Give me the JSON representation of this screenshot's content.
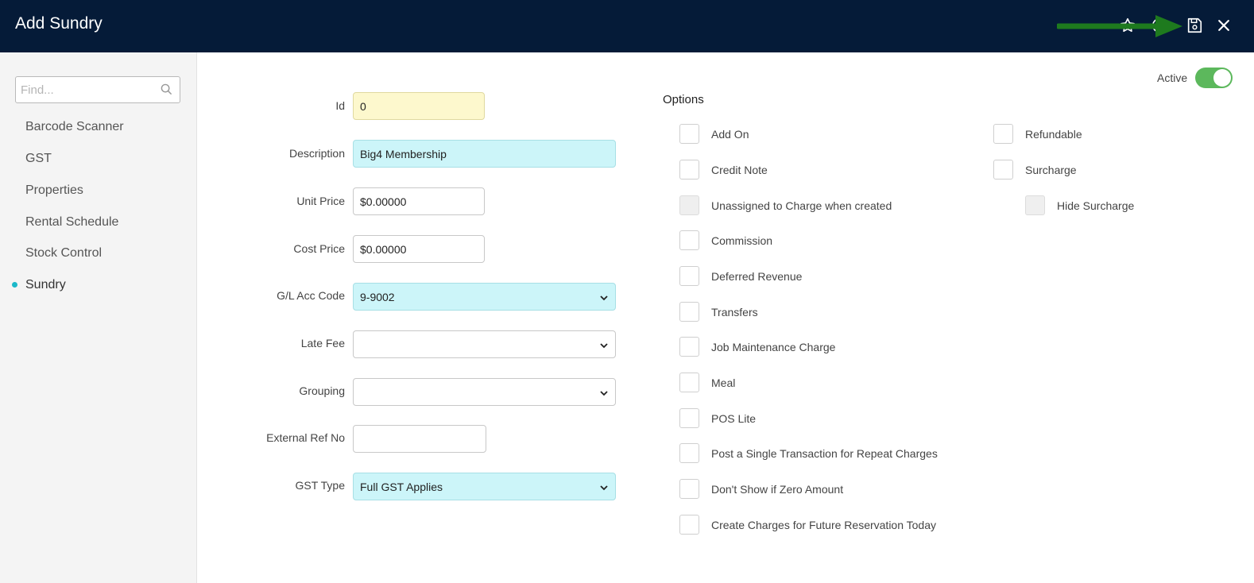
{
  "header": {
    "title": "Add Sundry",
    "icons": [
      "star-icon",
      "help-icon",
      "save-icon",
      "close-icon"
    ],
    "colors": {
      "background": "#051b38",
      "annotation_arrow": "#1e7a1e"
    }
  },
  "sidebar": {
    "search_placeholder": "Find...",
    "items": [
      {
        "label": "Barcode Scanner"
      },
      {
        "label": "GST"
      },
      {
        "label": "Properties"
      },
      {
        "label": "Rental Schedule"
      },
      {
        "label": "Stock Control"
      },
      {
        "label": "Sundry",
        "active": true
      }
    ]
  },
  "form": {
    "id": {
      "label": "Id",
      "value": "0"
    },
    "description": {
      "label": "Description",
      "value": "Big4 Membership"
    },
    "unit_price": {
      "label": "Unit Price",
      "value": "$0.00000"
    },
    "cost_price": {
      "label": "Cost Price",
      "value": "$0.00000"
    },
    "gl_acc_code": {
      "label": "G/L Acc Code",
      "value": "9-9002"
    },
    "late_fee": {
      "label": "Late Fee",
      "value": ""
    },
    "grouping": {
      "label": "Grouping",
      "value": ""
    },
    "external_ref_no": {
      "label": "External Ref No",
      "value": ""
    },
    "gst_type": {
      "label": "GST Type",
      "value": "Full GST Applies"
    }
  },
  "options": {
    "title": "Options",
    "left": [
      {
        "label": "Add On",
        "checked": false
      },
      {
        "label": "Credit Note",
        "checked": false
      },
      {
        "label": "Unassigned to Charge when created",
        "checked": false,
        "disabled": true
      },
      {
        "label": "Commission",
        "checked": false
      },
      {
        "label": "Deferred Revenue",
        "checked": false
      },
      {
        "label": "Transfers",
        "checked": false
      },
      {
        "label": "Job Maintenance Charge",
        "checked": false
      },
      {
        "label": "Meal",
        "checked": false
      },
      {
        "label": "POS Lite",
        "checked": false
      },
      {
        "label": "Post a Single Transaction for Repeat Charges",
        "checked": false
      },
      {
        "label": "Don't Show if Zero Amount",
        "checked": false
      },
      {
        "label": "Create Charges for Future Reservation Today",
        "checked": false
      }
    ],
    "right": [
      {
        "label": "Refundable",
        "checked": false
      },
      {
        "label": "Surcharge",
        "checked": false
      },
      {
        "label": "Hide Surcharge",
        "checked": false,
        "disabled": true
      }
    ]
  },
  "status": {
    "active_label": "Active",
    "active": true,
    "toggle_color": "#5cb85c"
  }
}
